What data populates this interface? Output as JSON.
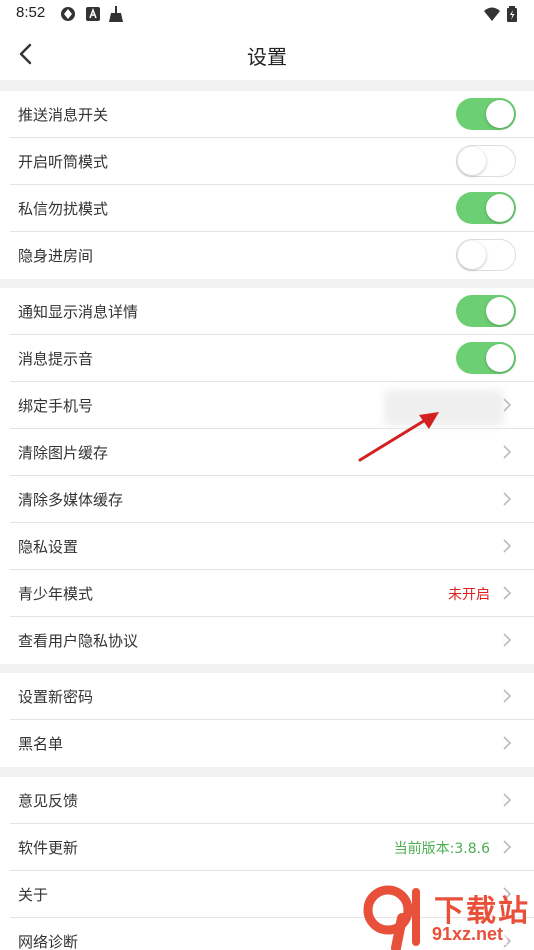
{
  "status_bar": {
    "time": "8:52",
    "left_icons": [
      "vpn-shield-icon",
      "text-a-icon",
      "broom-icon"
    ],
    "right_icons": [
      "wifi-icon",
      "battery-icon"
    ]
  },
  "header": {
    "title": "设置",
    "back_icon": "chevron-left-icon"
  },
  "groups": [
    {
      "rows": [
        {
          "label": "推送消息开关",
          "toggle": true
        },
        {
          "label": "开启听筒模式",
          "toggle": false
        },
        {
          "label": "私信勿扰模式",
          "toggle": true
        },
        {
          "label": "隐身进房间",
          "toggle": false
        }
      ]
    },
    {
      "rows": [
        {
          "label": "通知显示消息详情",
          "toggle": true
        },
        {
          "label": "消息提示音",
          "toggle": true
        },
        {
          "label": "绑定手机号"
        },
        {
          "label": "清除图片缓存"
        },
        {
          "label": "清除多媒体缓存"
        },
        {
          "label": "隐私设置"
        },
        {
          "label": "青少年模式",
          "value": "未开启",
          "value_color": "#e02020"
        },
        {
          "label": "查看用户隐私协议"
        }
      ]
    },
    {
      "rows": [
        {
          "label": "设置新密码"
        },
        {
          "label": "黑名单"
        }
      ]
    },
    {
      "rows": [
        {
          "label": "意见反馈"
        },
        {
          "label": "软件更新",
          "value": "当前版本:3.8.6",
          "value_color": "#4caf50"
        },
        {
          "label": "关于"
        },
        {
          "label": "网络诊断"
        }
      ]
    }
  ],
  "colors": {
    "toggle_on": "#6dcf74",
    "separator": "#f2f2f2",
    "accent_red": "#e02020",
    "accent_green": "#4caf50"
  },
  "watermark": {
    "text": "下载站",
    "url": "91xz.net"
  }
}
